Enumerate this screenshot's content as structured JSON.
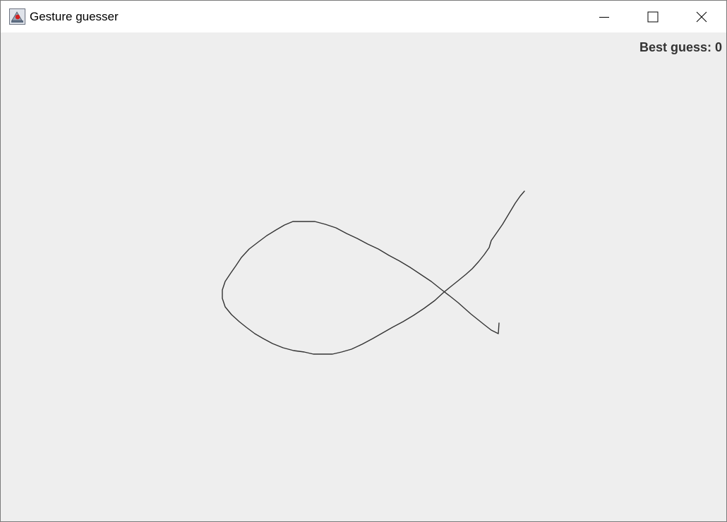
{
  "window": {
    "title": "Gesture guesser",
    "icon": "java-coffee-icon",
    "controls": [
      "minimize-icon",
      "maximize-icon",
      "close-icon"
    ]
  },
  "canvas": {
    "best_guess_label": "Best guess: 0",
    "stroke_color": "#333333",
    "background_color": "#eeeeee"
  }
}
